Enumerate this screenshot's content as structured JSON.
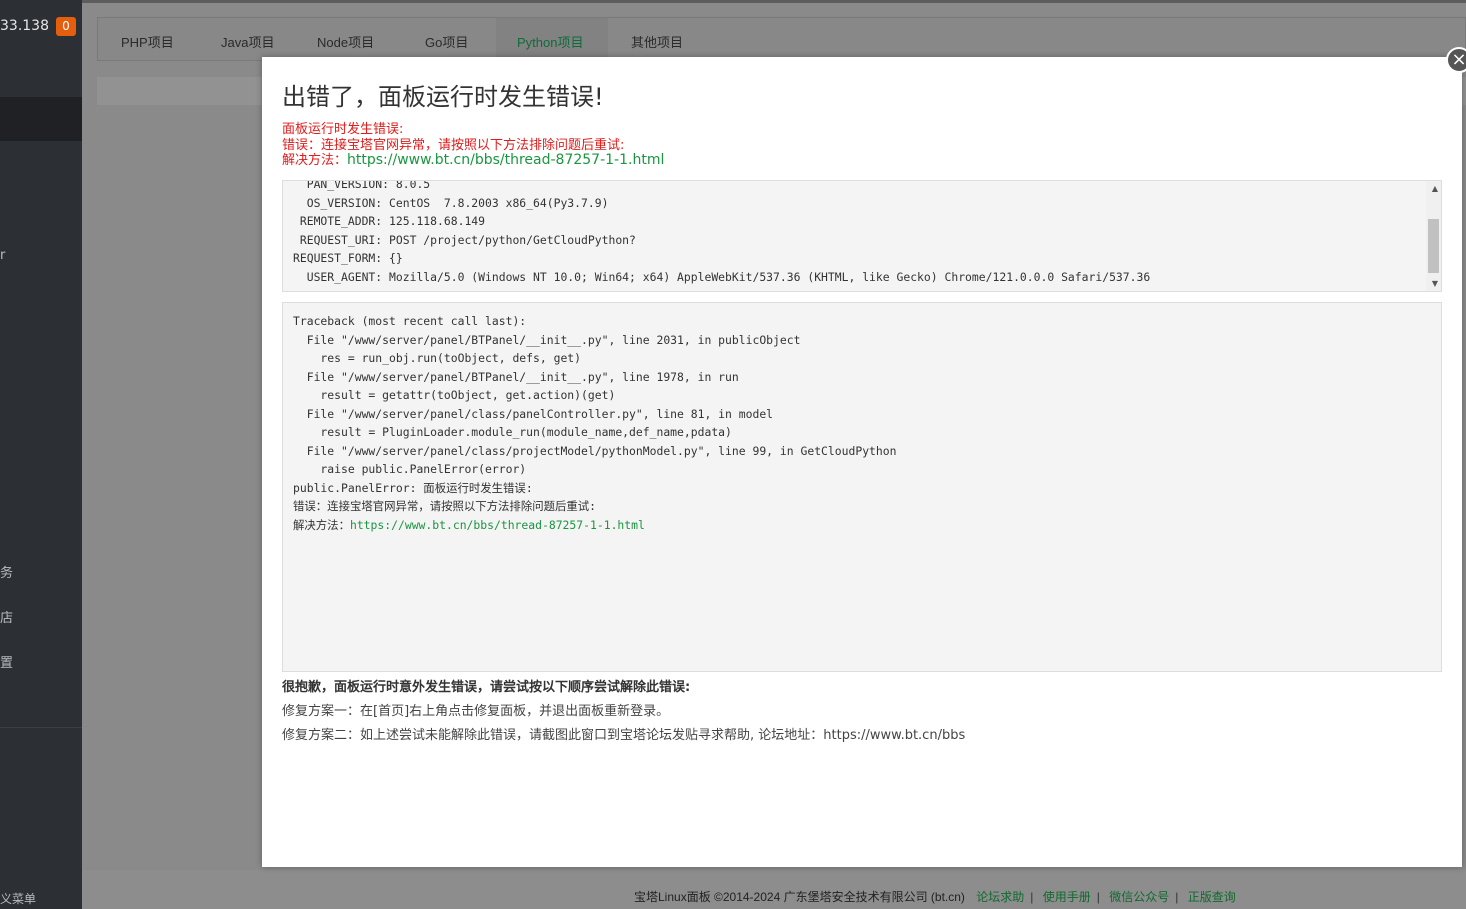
{
  "sidebar": {
    "ip_fragment": "33.138",
    "badge_count": "0",
    "frag_r": "r",
    "item_tasks": "务",
    "item_store": "店",
    "item_settings": "置",
    "custom_menu": "义菜单"
  },
  "tabs": [
    {
      "label": "PHP项目"
    },
    {
      "label": "Java项目"
    },
    {
      "label": "Node项目"
    },
    {
      "label": "Go项目"
    },
    {
      "label": "Python项目",
      "active": true
    },
    {
      "label": "其他项目"
    }
  ],
  "modal": {
    "close_label": "×",
    "title": "出错了，面板运行时发生错误!",
    "error_lines": [
      "面板运行时发生错误:",
      "错误：连接宝塔官网异常，请按照以下方法排除问题后重试:",
      "解决方法："
    ],
    "error_url": "https://www.bt.cn/bbs/thread-87257-1-1.html",
    "env_info": "  PAN_VERSION: 8.0.5\n  OS_VERSION: CentOS  7.8.2003 x86_64(Py3.7.9)\n REMOTE_ADDR: 125.118.68.149\n REQUEST_URI: POST /project/python/GetCloudPython?\nREQUEST_FORM: {}\n  USER_AGENT: Mozilla/5.0 (Windows NT 10.0; Win64; x64) AppleWebKit/537.36 (KHTML, like Gecko) Chrome/121.0.0.0 Safari/537.36",
    "traceback": "Traceback (most recent call last):\n  File \"/www/server/panel/BTPanel/__init__.py\", line 2031, in publicObject\n    res = run_obj.run(toObject, defs, get)\n  File \"/www/server/panel/BTPanel/__init__.py\", line 1978, in run\n    result = getattr(toObject, get.action)(get)\n  File \"/www/server/panel/class/panelController.py\", line 81, in model\n    result = PluginLoader.module_run(module_name,def_name,pdata)\n  File \"/www/server/panel/class/projectModel/pythonModel.py\", line 99, in GetCloudPython\n    raise public.PanelError(error)\npublic.PanelError: 面板运行时发生错误:\n错误：连接宝塔官网异常，请按照以下方法排除问题后重试:\n解决方法：",
    "traceback_url": "https://www.bt.cn/bbs/thread-87257-1-1.html",
    "tips_title": "很抱歉，面板运行时意外发生错误，请尝试按以下顺序尝试解除此错误:",
    "tip1": "修复方案一：在[首页]右上角点击修复面板，并退出面板重新登录。",
    "tip2": "修复方案二：如上述尝试未能解除此错误，请截图此窗口到宝塔论坛发贴寻求帮助, 论坛地址：https://www.bt.cn/bbs"
  },
  "footer": {
    "copyright": "宝塔Linux面板 ©2014-2024 广东堡塔安全技术有限公司 (bt.cn)",
    "links": [
      "论坛求助",
      "使用手册",
      "微信公众号",
      "正版查询"
    ]
  },
  "colors": {
    "error_red": "#e21b1b",
    "link_green": "#1a9640",
    "badge_orange": "#e35e0d",
    "sidebar_bg": "#2c2f33"
  }
}
